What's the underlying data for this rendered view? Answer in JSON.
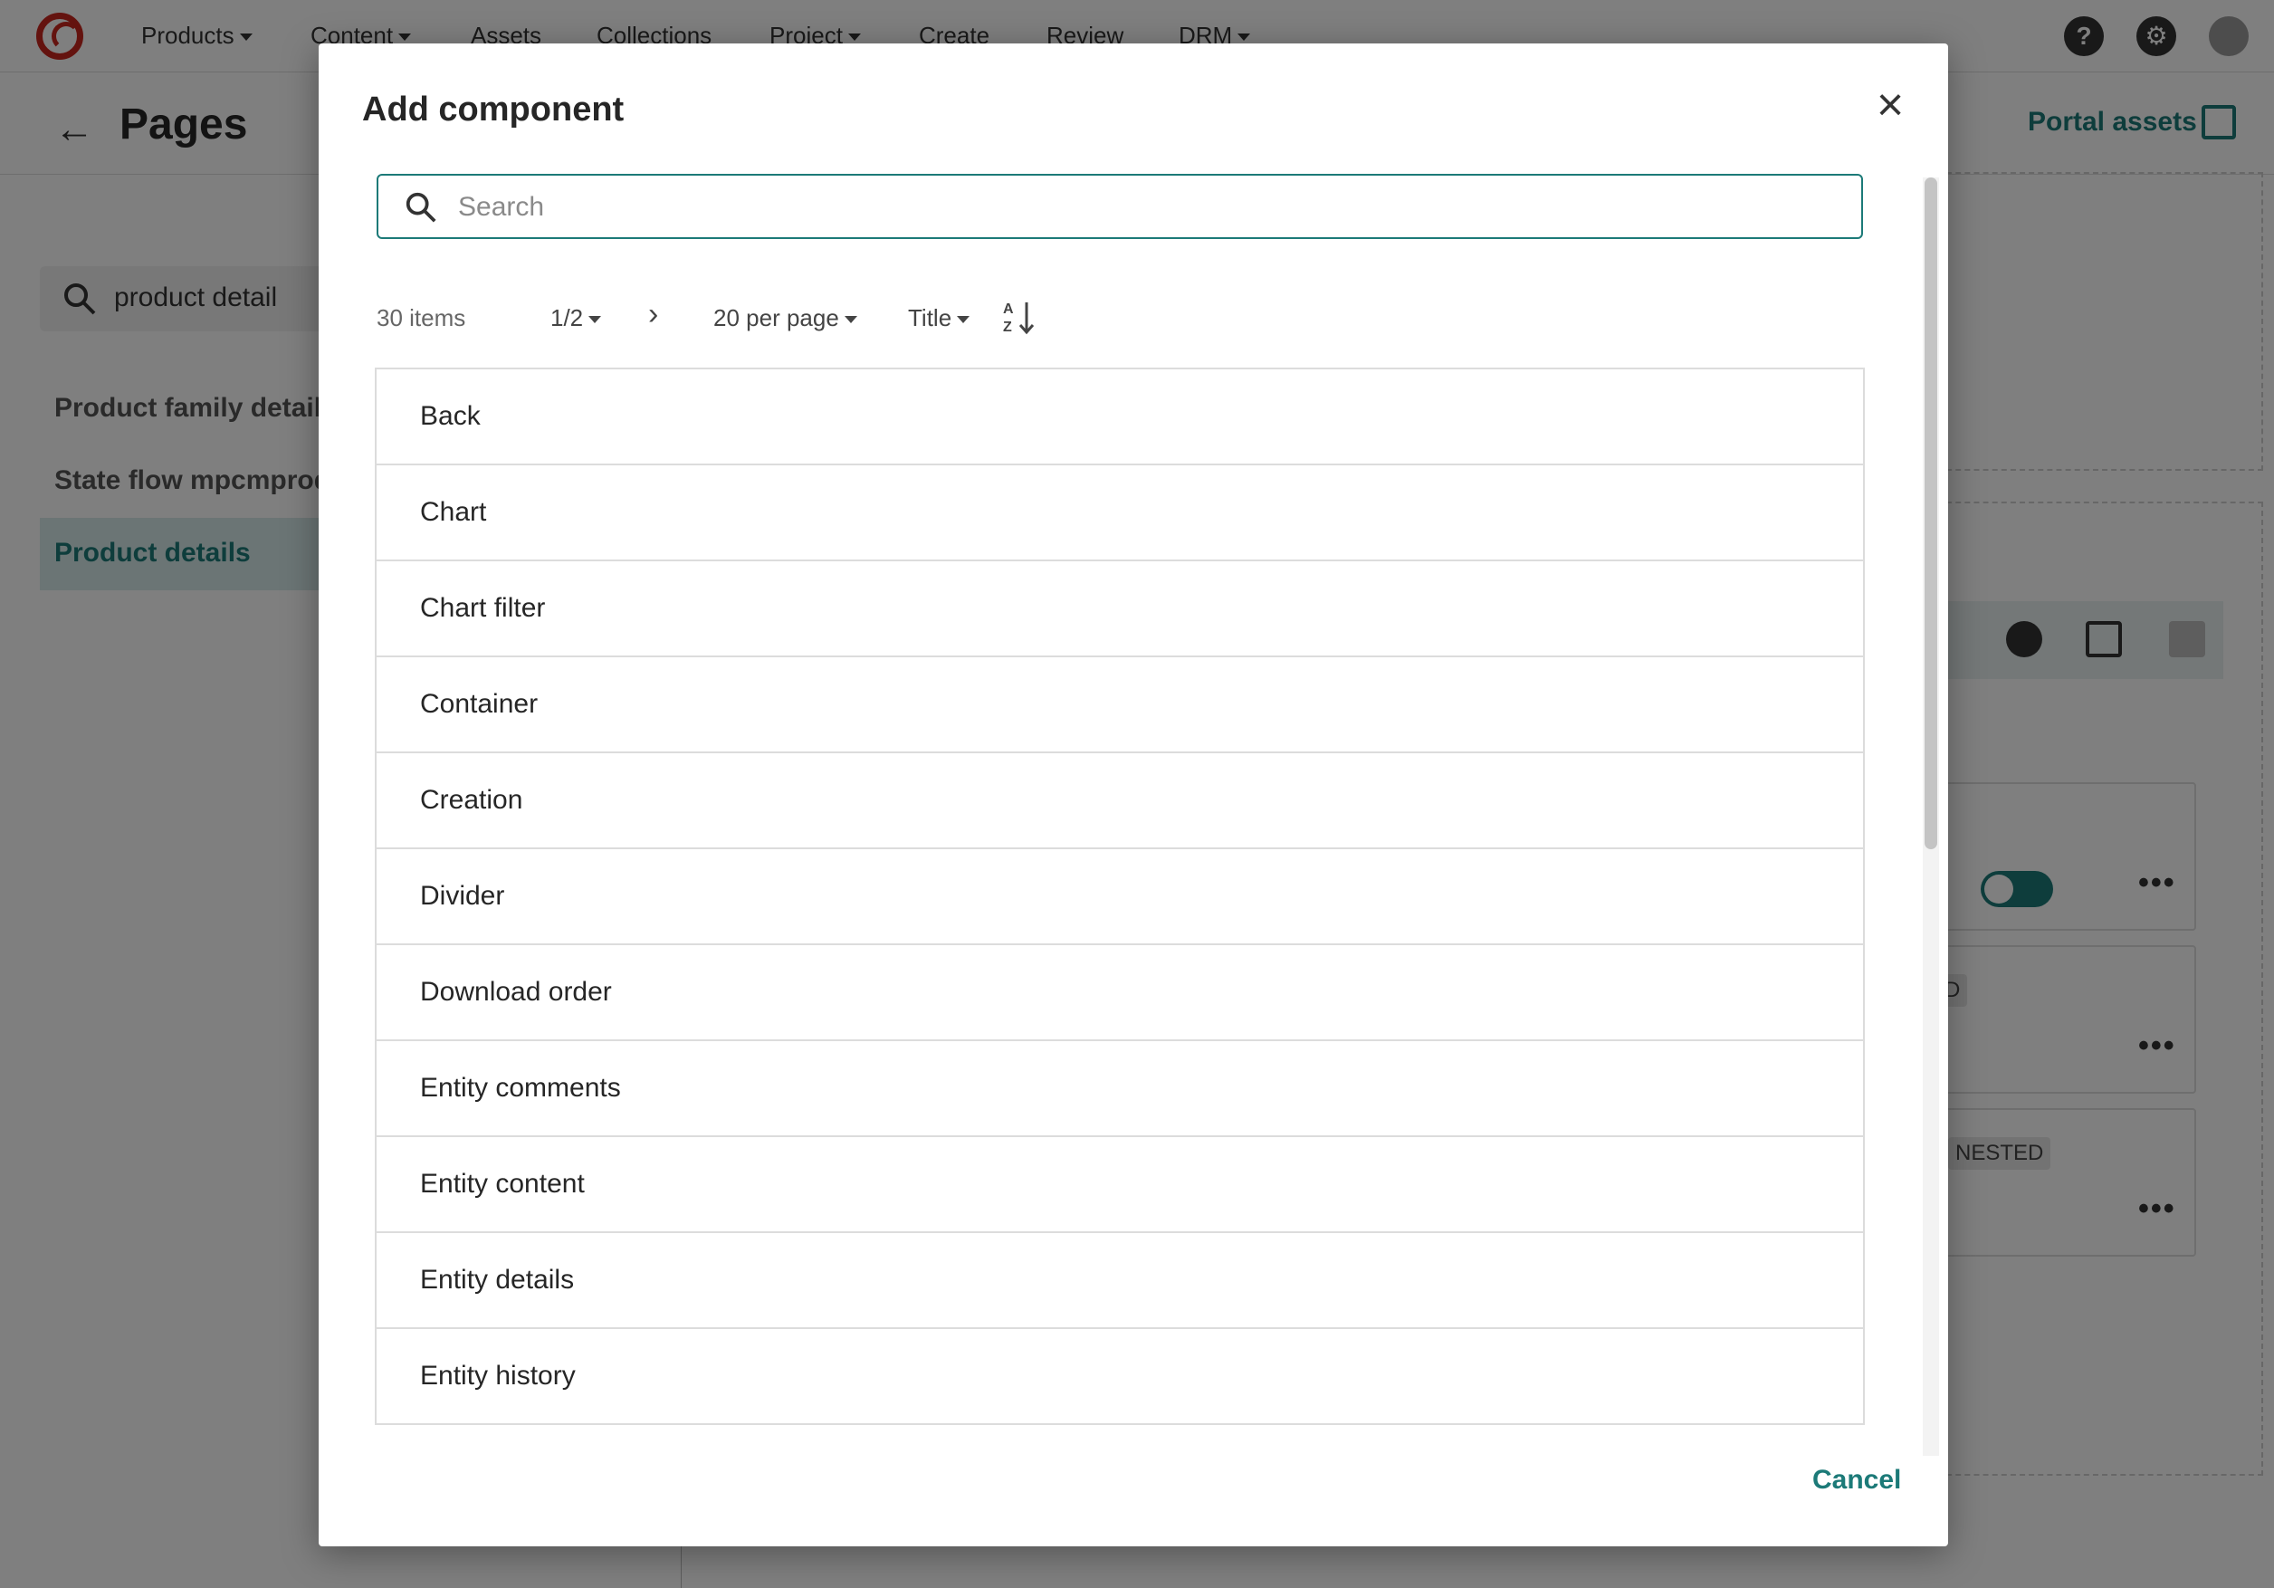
{
  "nav": {
    "items": [
      {
        "label": "Products",
        "caret": true
      },
      {
        "label": "Content",
        "caret": true
      },
      {
        "label": "Assets",
        "caret": false
      },
      {
        "label": "Collections",
        "caret": false
      },
      {
        "label": "Project",
        "caret": true
      },
      {
        "label": "Create",
        "caret": false
      },
      {
        "label": "Review",
        "caret": false
      },
      {
        "label": "DRM",
        "caret": true
      }
    ],
    "right_icons": [
      "help-icon",
      "gear-icon",
      "user-avatar-icon"
    ]
  },
  "header": {
    "title": "Pages",
    "portal_assets_label": "Portal assets"
  },
  "sidebar": {
    "search_value": "product detail",
    "items": [
      {
        "label": "Product family details",
        "active": false
      },
      {
        "label": "State flow mpcmprod",
        "active": false
      },
      {
        "label": "Product details",
        "active": true
      }
    ]
  },
  "right_area": {
    "tags": [
      "D",
      "NESTED"
    ],
    "toggle_on": true
  },
  "modal": {
    "title": "Add component",
    "search_placeholder": "Search",
    "search_value": "",
    "item_count": "30 items",
    "page": "1/2",
    "per_page": "20 per page",
    "sort_field": "Title",
    "sort_direction": "ascending",
    "items": [
      "Back",
      "Chart",
      "Chart filter",
      "Container",
      "Creation",
      "Divider",
      "Download order",
      "Entity comments",
      "Entity content",
      "Entity details",
      "Entity history"
    ],
    "cancel_label": "Cancel",
    "accent_color": "#1c7a78"
  }
}
